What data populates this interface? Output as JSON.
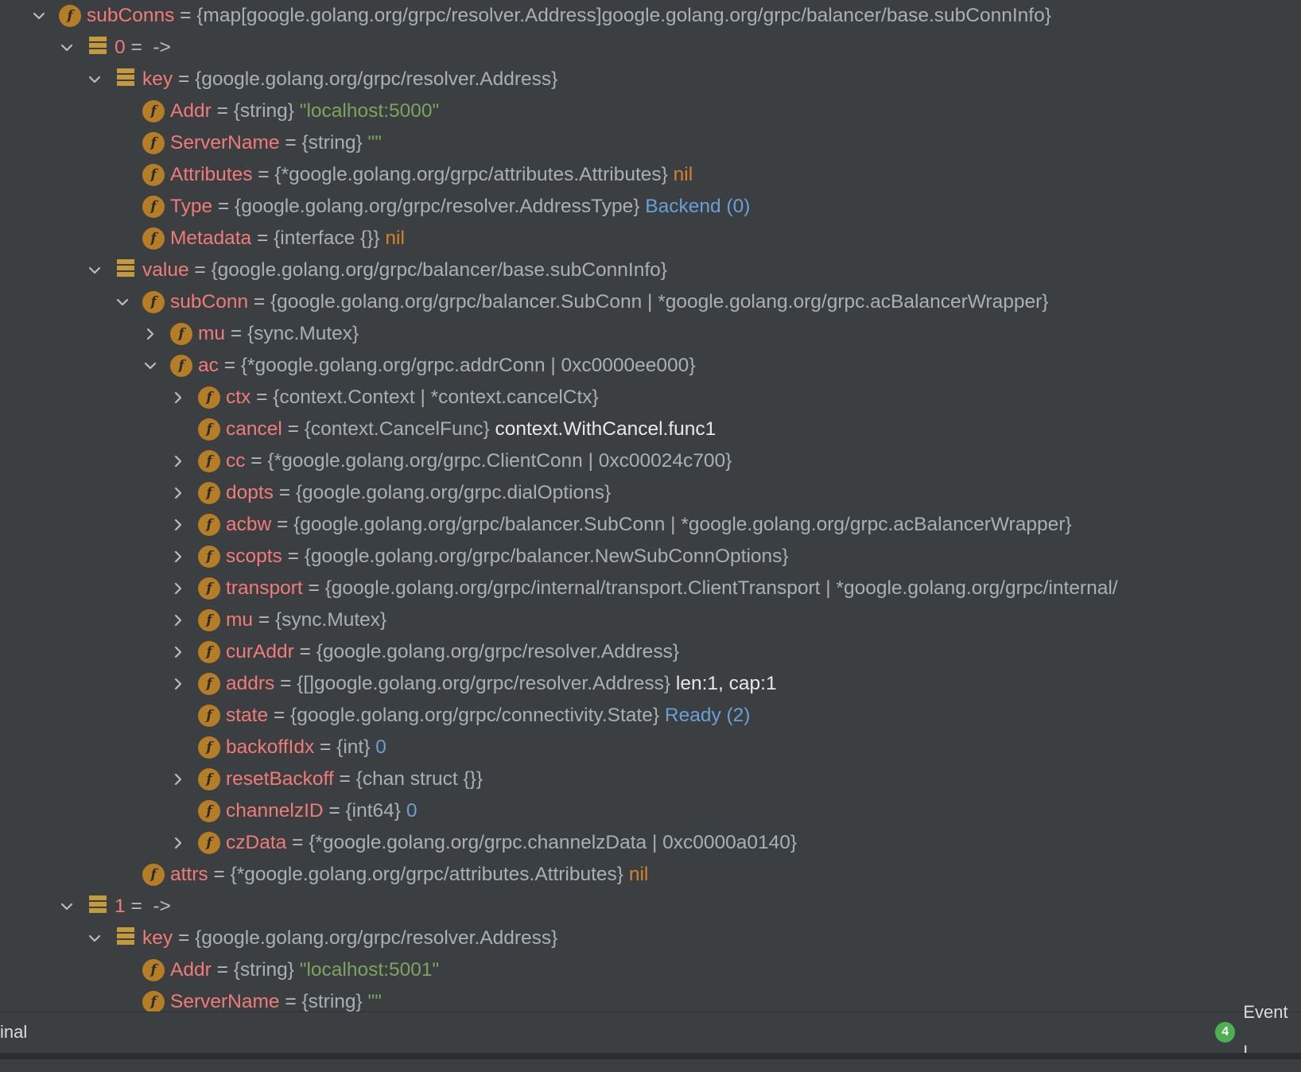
{
  "tree": [
    {
      "depth": 1,
      "toggle": "expanded",
      "icon": "field",
      "name": "subConns",
      "eq": "=",
      "type": "{map[google.golang.org/grpc/resolver.Address]google.golang.org/grpc/balancer/base.subConnInfo}",
      "value": "",
      "value_kind": ""
    },
    {
      "depth": 2,
      "toggle": "expanded",
      "icon": "map-entry",
      "name": "0",
      "eq": "=  ->",
      "type": "",
      "value": "",
      "value_kind": ""
    },
    {
      "depth": 3,
      "toggle": "expanded",
      "icon": "map-entry",
      "name": "key",
      "eq": "=",
      "type": "{google.golang.org/grpc/resolver.Address}",
      "value": "",
      "value_kind": ""
    },
    {
      "depth": 4,
      "toggle": "none",
      "icon": "field",
      "name": "Addr",
      "eq": "=",
      "type": "{string}",
      "value": "\"localhost:5000\"",
      "value_kind": "string"
    },
    {
      "depth": 4,
      "toggle": "none",
      "icon": "field",
      "name": "ServerName",
      "eq": "=",
      "type": "{string}",
      "value": "\"\"",
      "value_kind": "string"
    },
    {
      "depth": 4,
      "toggle": "none",
      "icon": "field",
      "name": "Attributes",
      "eq": "=",
      "type": "{*google.golang.org/grpc/attributes.Attributes}",
      "value": "nil",
      "value_kind": "keyword"
    },
    {
      "depth": 4,
      "toggle": "none",
      "icon": "field",
      "name": "Type",
      "eq": "=",
      "type": "{google.golang.org/grpc/resolver.AddressType}",
      "value": "Backend (0)",
      "value_kind": "number"
    },
    {
      "depth": 4,
      "toggle": "none",
      "icon": "field",
      "name": "Metadata",
      "eq": "=",
      "type": "{interface {}}",
      "value": "nil",
      "value_kind": "keyword"
    },
    {
      "depth": 3,
      "toggle": "expanded",
      "icon": "map-entry",
      "name": "value",
      "eq": "=",
      "type": "{google.golang.org/grpc/balancer/base.subConnInfo}",
      "value": "",
      "value_kind": ""
    },
    {
      "depth": 4,
      "toggle": "expanded",
      "icon": "field",
      "name": "subConn",
      "eq": "=",
      "type": "{google.golang.org/grpc/balancer.SubConn | *google.golang.org/grpc.acBalancerWrapper}",
      "value": "",
      "value_kind": ""
    },
    {
      "depth": 5,
      "toggle": "collapsed",
      "icon": "field",
      "name": "mu",
      "eq": "=",
      "type": "{sync.Mutex}",
      "value": "",
      "value_kind": ""
    },
    {
      "depth": 5,
      "toggle": "expanded",
      "icon": "field",
      "name": "ac",
      "eq": "=",
      "type": "{*google.golang.org/grpc.addrConn | 0xc0000ee000}",
      "value": "",
      "value_kind": ""
    },
    {
      "depth": 6,
      "toggle": "collapsed",
      "icon": "field",
      "name": "ctx",
      "eq": "=",
      "type": "{context.Context | *context.cancelCtx}",
      "value": "",
      "value_kind": ""
    },
    {
      "depth": 6,
      "toggle": "none",
      "icon": "field",
      "name": "cancel",
      "eq": "=",
      "type": "{context.CancelFunc}",
      "value": "context.WithCancel.func1",
      "value_kind": "plain"
    },
    {
      "depth": 6,
      "toggle": "collapsed",
      "icon": "field",
      "name": "cc",
      "eq": "=",
      "type": "{*google.golang.org/grpc.ClientConn | 0xc00024c700}",
      "value": "",
      "value_kind": ""
    },
    {
      "depth": 6,
      "toggle": "collapsed",
      "icon": "field",
      "name": "dopts",
      "eq": "=",
      "type": "{google.golang.org/grpc.dialOptions}",
      "value": "",
      "value_kind": ""
    },
    {
      "depth": 6,
      "toggle": "collapsed",
      "icon": "field",
      "name": "acbw",
      "eq": "=",
      "type": "{google.golang.org/grpc/balancer.SubConn | *google.golang.org/grpc.acBalancerWrapper}",
      "value": "",
      "value_kind": ""
    },
    {
      "depth": 6,
      "toggle": "collapsed",
      "icon": "field",
      "name": "scopts",
      "eq": "=",
      "type": "{google.golang.org/grpc/balancer.NewSubConnOptions}",
      "value": "",
      "value_kind": ""
    },
    {
      "depth": 6,
      "toggle": "collapsed",
      "icon": "field",
      "name": "transport",
      "eq": "=",
      "type": "{google.golang.org/grpc/internal/transport.ClientTransport | *google.golang.org/grpc/internal/",
      "value": "",
      "value_kind": ""
    },
    {
      "depth": 6,
      "toggle": "collapsed",
      "icon": "field",
      "name": "mu",
      "eq": "=",
      "type": "{sync.Mutex}",
      "value": "",
      "value_kind": ""
    },
    {
      "depth": 6,
      "toggle": "collapsed",
      "icon": "field",
      "name": "curAddr",
      "eq": "=",
      "type": "{google.golang.org/grpc/resolver.Address}",
      "value": "",
      "value_kind": ""
    },
    {
      "depth": 6,
      "toggle": "collapsed",
      "icon": "field",
      "name": "addrs",
      "eq": "=",
      "type": "{[]google.golang.org/grpc/resolver.Address}",
      "value": "len:1, cap:1",
      "value_kind": "plain"
    },
    {
      "depth": 6,
      "toggle": "none",
      "icon": "field",
      "name": "state",
      "eq": "=",
      "type": "{google.golang.org/grpc/connectivity.State}",
      "value": "Ready (2)",
      "value_kind": "number"
    },
    {
      "depth": 6,
      "toggle": "none",
      "icon": "field",
      "name": "backoffIdx",
      "eq": "=",
      "type": "{int}",
      "value": "0",
      "value_kind": "number"
    },
    {
      "depth": 6,
      "toggle": "collapsed",
      "icon": "field",
      "name": "resetBackoff",
      "eq": "=",
      "type": "{chan struct {}}",
      "value": "",
      "value_kind": ""
    },
    {
      "depth": 6,
      "toggle": "none",
      "icon": "field",
      "name": "channelzID",
      "eq": "=",
      "type": "{int64}",
      "value": "0",
      "value_kind": "number"
    },
    {
      "depth": 6,
      "toggle": "collapsed",
      "icon": "field",
      "name": "czData",
      "eq": "=",
      "type": "{*google.golang.org/grpc.channelzData | 0xc0000a0140}",
      "value": "",
      "value_kind": ""
    },
    {
      "depth": 4,
      "toggle": "none",
      "icon": "field",
      "name": "attrs",
      "eq": "=",
      "type": "{*google.golang.org/grpc/attributes.Attributes}",
      "value": "nil",
      "value_kind": "keyword"
    },
    {
      "depth": 2,
      "toggle": "expanded",
      "icon": "map-entry",
      "name": "1",
      "eq": "=  ->",
      "type": "",
      "value": "",
      "value_kind": ""
    },
    {
      "depth": 3,
      "toggle": "expanded",
      "icon": "map-entry",
      "name": "key",
      "eq": "=",
      "type": "{google.golang.org/grpc/resolver.Address}",
      "value": "",
      "value_kind": ""
    },
    {
      "depth": 4,
      "toggle": "none",
      "icon": "field",
      "name": "Addr",
      "eq": "=",
      "type": "{string}",
      "value": "\"localhost:5001\"",
      "value_kind": "string"
    },
    {
      "depth": 4,
      "toggle": "none",
      "icon": "field",
      "name": "ServerName",
      "eq": "=",
      "type": "{string}",
      "value": "\"\"",
      "value_kind": "string"
    }
  ],
  "field_icon_letter": "f",
  "statusbar": {
    "left_label": "inal",
    "event_count": "4",
    "event_label": "Event L"
  }
}
